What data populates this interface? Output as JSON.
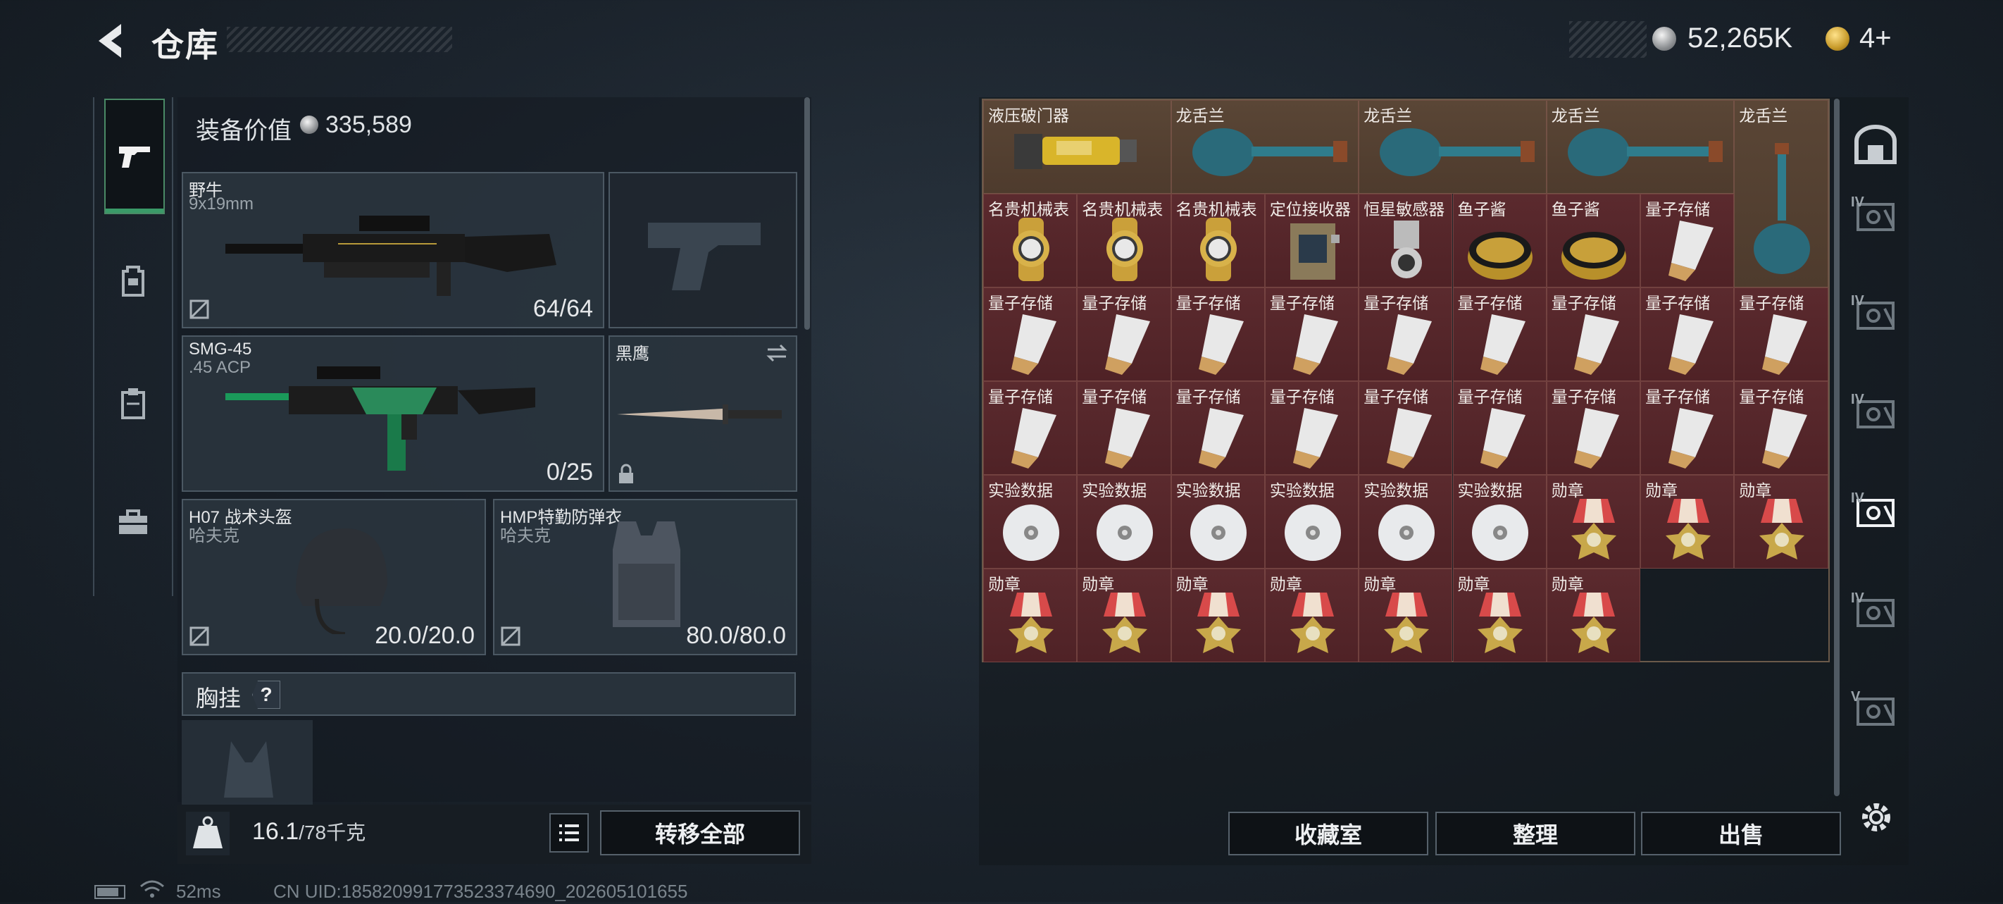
{
  "header": {
    "title": "仓库",
    "currency": [
      {
        "icon": "silver-coin-icon",
        "value": "52,265K"
      },
      {
        "icon": "gold-coin-icon",
        "value": "4+"
      }
    ]
  },
  "side_tabs": [
    {
      "name": "pistol-icon",
      "active": true
    },
    {
      "name": "backpack-icon",
      "active": false
    },
    {
      "name": "clipboard-icon",
      "active": false
    },
    {
      "name": "toolbox-icon",
      "active": false
    }
  ],
  "equipment": {
    "value_label": "装备价值",
    "value": "335,589",
    "slots": {
      "primary": {
        "name": "野牛",
        "sub": "9x19mm",
        "value": "64/64"
      },
      "pistol": {
        "name": "",
        "sub": "",
        "value": ""
      },
      "secondary": {
        "name": "SMG-45",
        "sub": ".45 ACP",
        "value": "0/25"
      },
      "melee": {
        "name": "黑鹰"
      },
      "helmet": {
        "name": "H07 战术头盔",
        "sub": "哈夫克",
        "value": "20.0/20.0"
      },
      "armor": {
        "name": "HMP特勤防弹衣",
        "sub": "哈夫克",
        "value": "80.0/80.0"
      }
    },
    "chest_label": "胸挂",
    "chest_help": "?"
  },
  "weight": {
    "current": "16.1",
    "max": "/78千克"
  },
  "transfer_all": "转移全部",
  "status_bar": {
    "ping": "52ms",
    "uid": "CN UID:185820991773523374690_202605101655"
  },
  "inventory": {
    "items": [
      {
        "name": "液压破门器",
        "type": "breacher",
        "bg": "brown"
      },
      {
        "name": "龙舌兰",
        "type": "tequila-h",
        "bg": "brown"
      },
      {
        "name": "龙舌兰",
        "type": "tequila-h",
        "bg": "brown"
      },
      {
        "name": "龙舌兰",
        "type": "tequila-h",
        "bg": "brown"
      },
      {
        "name": "龙舌兰",
        "type": "tequila-v",
        "bg": "brown"
      },
      {
        "name": "名贵机械表",
        "type": "watch",
        "bg": "red"
      },
      {
        "name": "名贵机械表",
        "type": "watch",
        "bg": "red"
      },
      {
        "name": "名贵机械表",
        "type": "watch",
        "bg": "red"
      },
      {
        "name": "定位接收器",
        "type": "receiver",
        "bg": "red"
      },
      {
        "name": "恒星敏感器",
        "type": "sensor",
        "bg": "red"
      },
      {
        "name": "鱼子酱",
        "type": "caviar",
        "bg": "red"
      },
      {
        "name": "鱼子酱",
        "type": "caviar",
        "bg": "red"
      },
      {
        "name": "量子存储",
        "type": "usb",
        "bg": "red"
      },
      {
        "name": "量子存储",
        "type": "usb",
        "bg": "red"
      },
      {
        "name": "量子存储",
        "type": "usb",
        "bg": "red"
      },
      {
        "name": "量子存储",
        "type": "usb",
        "bg": "red"
      },
      {
        "name": "量子存储",
        "type": "usb",
        "bg": "red"
      },
      {
        "name": "量子存储",
        "type": "usb",
        "bg": "red"
      },
      {
        "name": "量子存储",
        "type": "usb",
        "bg": "red"
      },
      {
        "name": "量子存储",
        "type": "usb",
        "bg": "red"
      },
      {
        "name": "量子存储",
        "type": "usb",
        "bg": "red"
      },
      {
        "name": "量子存储",
        "type": "usb",
        "bg": "red"
      },
      {
        "name": "量子存储",
        "type": "usb",
        "bg": "red"
      },
      {
        "name": "量子存储",
        "type": "usb",
        "bg": "red"
      },
      {
        "name": "量子存储",
        "type": "usb",
        "bg": "red"
      },
      {
        "name": "量子存储",
        "type": "usb",
        "bg": "red"
      },
      {
        "name": "量子存储",
        "type": "usb",
        "bg": "red"
      },
      {
        "name": "量子存储",
        "type": "usb",
        "bg": "red"
      },
      {
        "name": "量子存储",
        "type": "usb",
        "bg": "red"
      },
      {
        "name": "量子存储",
        "type": "usb",
        "bg": "red"
      },
      {
        "name": "量子存储",
        "type": "usb",
        "bg": "red"
      },
      {
        "name": "实验数据",
        "type": "disc",
        "bg": "red"
      },
      {
        "name": "实验数据",
        "type": "disc",
        "bg": "red"
      },
      {
        "name": "实验数据",
        "type": "disc",
        "bg": "red"
      },
      {
        "name": "实验数据",
        "type": "disc",
        "bg": "red"
      },
      {
        "name": "实验数据",
        "type": "disc",
        "bg": "red"
      },
      {
        "name": "实验数据",
        "type": "disc",
        "bg": "red"
      },
      {
        "name": "勋章",
        "type": "medal",
        "bg": "red"
      },
      {
        "name": "勋章",
        "type": "medal",
        "bg": "red"
      },
      {
        "name": "勋章",
        "type": "medal",
        "bg": "red"
      },
      {
        "name": "勋章",
        "type": "medal",
        "bg": "red"
      },
      {
        "name": "勋章",
        "type": "medal",
        "bg": "red"
      },
      {
        "name": "勋章",
        "type": "medal",
        "bg": "red"
      },
      {
        "name": "勋章",
        "type": "medal",
        "bg": "red"
      },
      {
        "name": "勋章",
        "type": "medal",
        "bg": "red"
      },
      {
        "name": "勋章",
        "type": "medal",
        "bg": "red"
      },
      {
        "name": "勋章",
        "type": "medal",
        "bg": "red"
      }
    ]
  },
  "actions": {
    "collection": "收藏室",
    "organize": "整理",
    "sell": "出售"
  },
  "right_strip": [
    {
      "name": "safe-icon",
      "label": ""
    },
    {
      "name": "container-iv-icon",
      "label": "IV"
    },
    {
      "name": "container-iv-icon",
      "label": "IV"
    },
    {
      "name": "container-iv-icon",
      "label": "IV"
    },
    {
      "name": "container-iv-icon",
      "label": "IV"
    },
    {
      "name": "container-iv-icon",
      "label": "IV"
    },
    {
      "name": "container-v-icon",
      "label": "V"
    }
  ],
  "colors": {
    "accent": "#3a9a68",
    "rare_bg": "#5b2a2e",
    "uncommon_bg": "#5a4636"
  }
}
